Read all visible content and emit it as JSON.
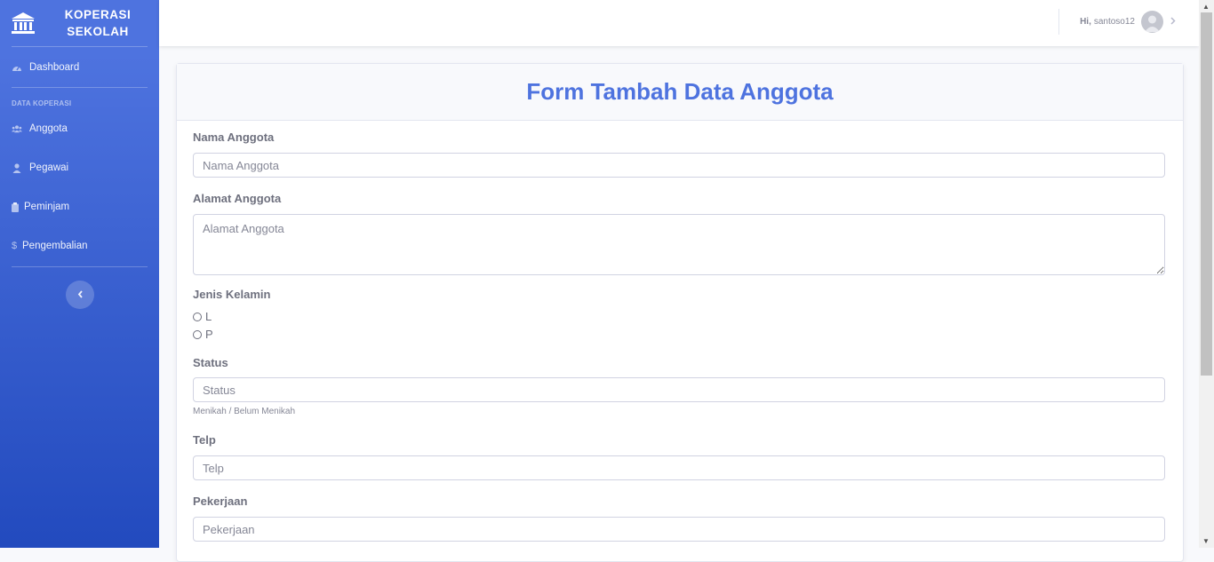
{
  "brand": {
    "line1": "KOPERASI",
    "line2": "SEKOLAH",
    "icon": "bank-icon"
  },
  "sidebar": {
    "dashboard": {
      "label": "Dashboard",
      "icon": "tachometer-icon"
    },
    "heading": "DATA KOPERASI",
    "items": [
      {
        "label": "Anggota",
        "icon": "users-icon"
      },
      {
        "label": "Pegawai",
        "icon": "user-icon"
      },
      {
        "label": "Peminjam",
        "icon": "clipboard-icon"
      },
      {
        "label": "Pengembalian",
        "icon": "dollar-icon"
      }
    ],
    "toggle_icon": "chevron-left-icon"
  },
  "topbar": {
    "greeting": "Hi,",
    "username": "santoso12"
  },
  "form": {
    "title": "Form Tambah Data Anggota",
    "nama": {
      "label": "Nama Anggota",
      "placeholder": "Nama Anggota"
    },
    "alamat": {
      "label": "Alamat Anggota",
      "placeholder": "Alamat Anggota"
    },
    "jenis_kelamin": {
      "label": "Jenis Kelamin",
      "options": [
        "L",
        "P"
      ]
    },
    "status": {
      "label": "Status",
      "placeholder": "Status",
      "help": "Menikah / Belum Menikah"
    },
    "telp": {
      "label": "Telp",
      "placeholder": "Telp"
    },
    "pekerjaan": {
      "label": "Pekerjaan",
      "placeholder": "Pekerjaan"
    }
  },
  "colors": {
    "primary": "#4e73df",
    "sidebar_bottom": "#224abe"
  }
}
